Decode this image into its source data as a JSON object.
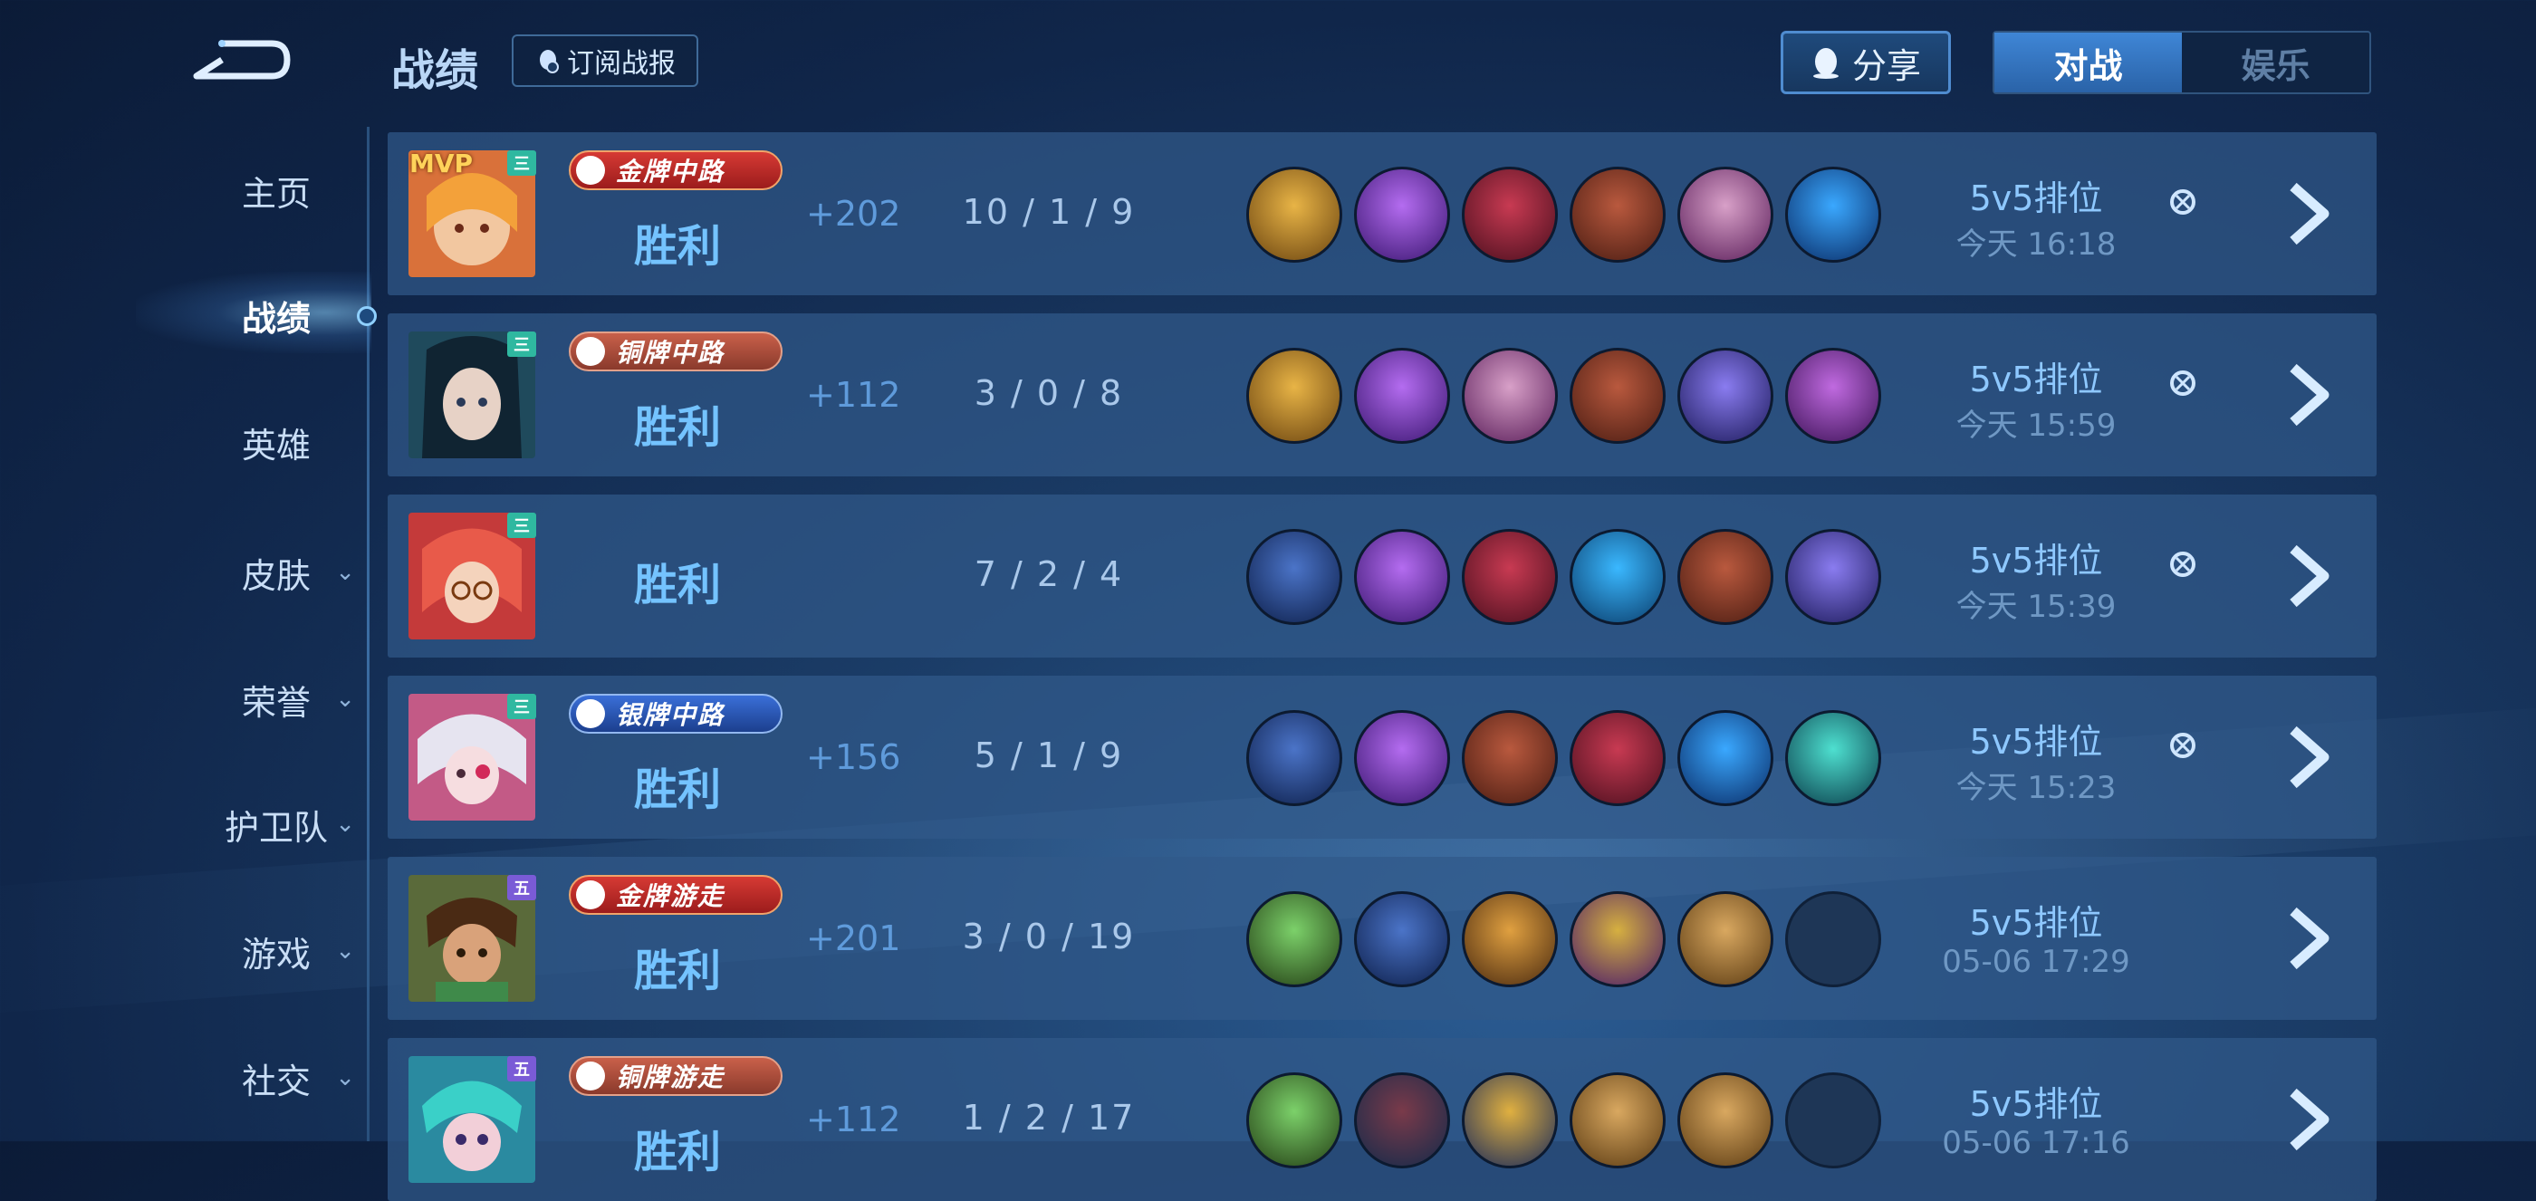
{
  "header": {
    "title": "战绩",
    "subscribe_label": "订阅战报",
    "share_label": "分享",
    "tabs": [
      {
        "label": "对战",
        "active": true
      },
      {
        "label": "娱乐",
        "active": false
      }
    ]
  },
  "sidebar": {
    "items": [
      {
        "label": "主页",
        "active": false,
        "expandable": false
      },
      {
        "label": "战绩",
        "active": true,
        "expandable": false
      },
      {
        "label": "英雄",
        "active": false,
        "expandable": false
      },
      {
        "label": "皮肤",
        "active": false,
        "expandable": true
      },
      {
        "label": "荣誉",
        "active": false,
        "expandable": true
      },
      {
        "label": "护卫队",
        "active": false,
        "expandable": true
      },
      {
        "label": "游戏",
        "active": false,
        "expandable": true
      },
      {
        "label": "社交",
        "active": false,
        "expandable": true
      }
    ]
  },
  "matches": [
    {
      "mvp": "MVP",
      "rank_tag": "三",
      "badge": "金牌中路",
      "result": "胜利",
      "score": "+202",
      "kda": "10 / 1 / 9",
      "mode": "5v5排位",
      "time": "今天 16:18"
    },
    {
      "mvp": "",
      "rank_tag": "三",
      "badge": "铜牌中路",
      "result": "胜利",
      "score": "+112",
      "kda": "3 / 0 / 8",
      "mode": "5v5排位",
      "time": "今天 15:59"
    },
    {
      "mvp": "",
      "rank_tag": "三",
      "badge": "",
      "result": "胜利",
      "score": "",
      "kda": "7 / 2 / 4",
      "mode": "5v5排位",
      "time": "今天 15:39"
    },
    {
      "mvp": "",
      "rank_tag": "三",
      "badge": "银牌中路",
      "result": "胜利",
      "score": "+156",
      "kda": "5 / 1 / 9",
      "mode": "5v5排位",
      "time": "今天 15:23"
    },
    {
      "mvp": "",
      "rank_tag": "五",
      "badge": "金牌游走",
      "result": "胜利",
      "score": "+201",
      "kda": "3 / 0 / 19",
      "mode": "5v5排位",
      "time": "05-06  17:29"
    },
    {
      "mvp": "",
      "rank_tag": "五",
      "badge": "铜牌游走",
      "result": "胜利",
      "score": "+112",
      "kda": "1 / 2 / 17",
      "mode": "5v5排位",
      "time": "05-06  17:16"
    }
  ],
  "colors": {
    "accent": "#74c3ff",
    "badge_gold": "#c62f2b",
    "badge_bronze": "#b45440",
    "badge_silver": "#2f5fc4"
  }
}
